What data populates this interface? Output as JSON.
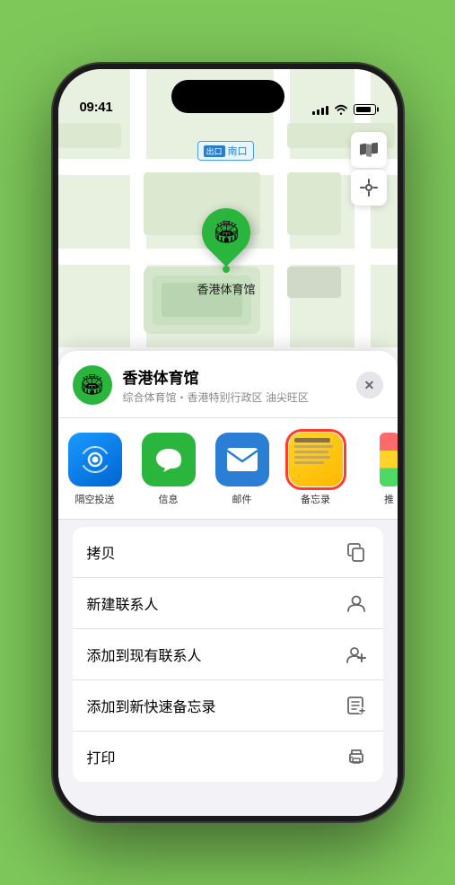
{
  "phone": {
    "time": "09:41",
    "location_arrow": "▶",
    "signal": [
      3,
      5,
      7,
      9,
      11
    ],
    "wifi": true,
    "battery": 85
  },
  "map": {
    "label_badge": "出口",
    "label_text": "南口",
    "stadium_name": "香港体育馆",
    "stadium_emoji": "🏟",
    "map_btn_map": "🗺",
    "map_btn_location": "◎"
  },
  "sheet": {
    "icon": "🏟",
    "title": "香港体育馆",
    "subtitle": "综合体育馆・香港特别行政区 油尖旺区",
    "close": "✕"
  },
  "apps": [
    {
      "id": "airdrop",
      "label": "隔空投送",
      "emoji": "📡"
    },
    {
      "id": "messages",
      "label": "信息",
      "emoji": "💬"
    },
    {
      "id": "mail",
      "label": "邮件",
      "emoji": "✉"
    },
    {
      "id": "notes",
      "label": "备忘录",
      "type": "notes"
    },
    {
      "id": "more",
      "label": "推",
      "type": "more"
    }
  ],
  "actions": [
    {
      "id": "copy",
      "label": "拷贝",
      "icon": "copy"
    },
    {
      "id": "new-contact",
      "label": "新建联系人",
      "icon": "person"
    },
    {
      "id": "add-existing",
      "label": "添加到现有联系人",
      "icon": "person-add"
    },
    {
      "id": "add-notes",
      "label": "添加到新快速备忘录",
      "icon": "note"
    },
    {
      "id": "print",
      "label": "打印",
      "icon": "print"
    }
  ]
}
